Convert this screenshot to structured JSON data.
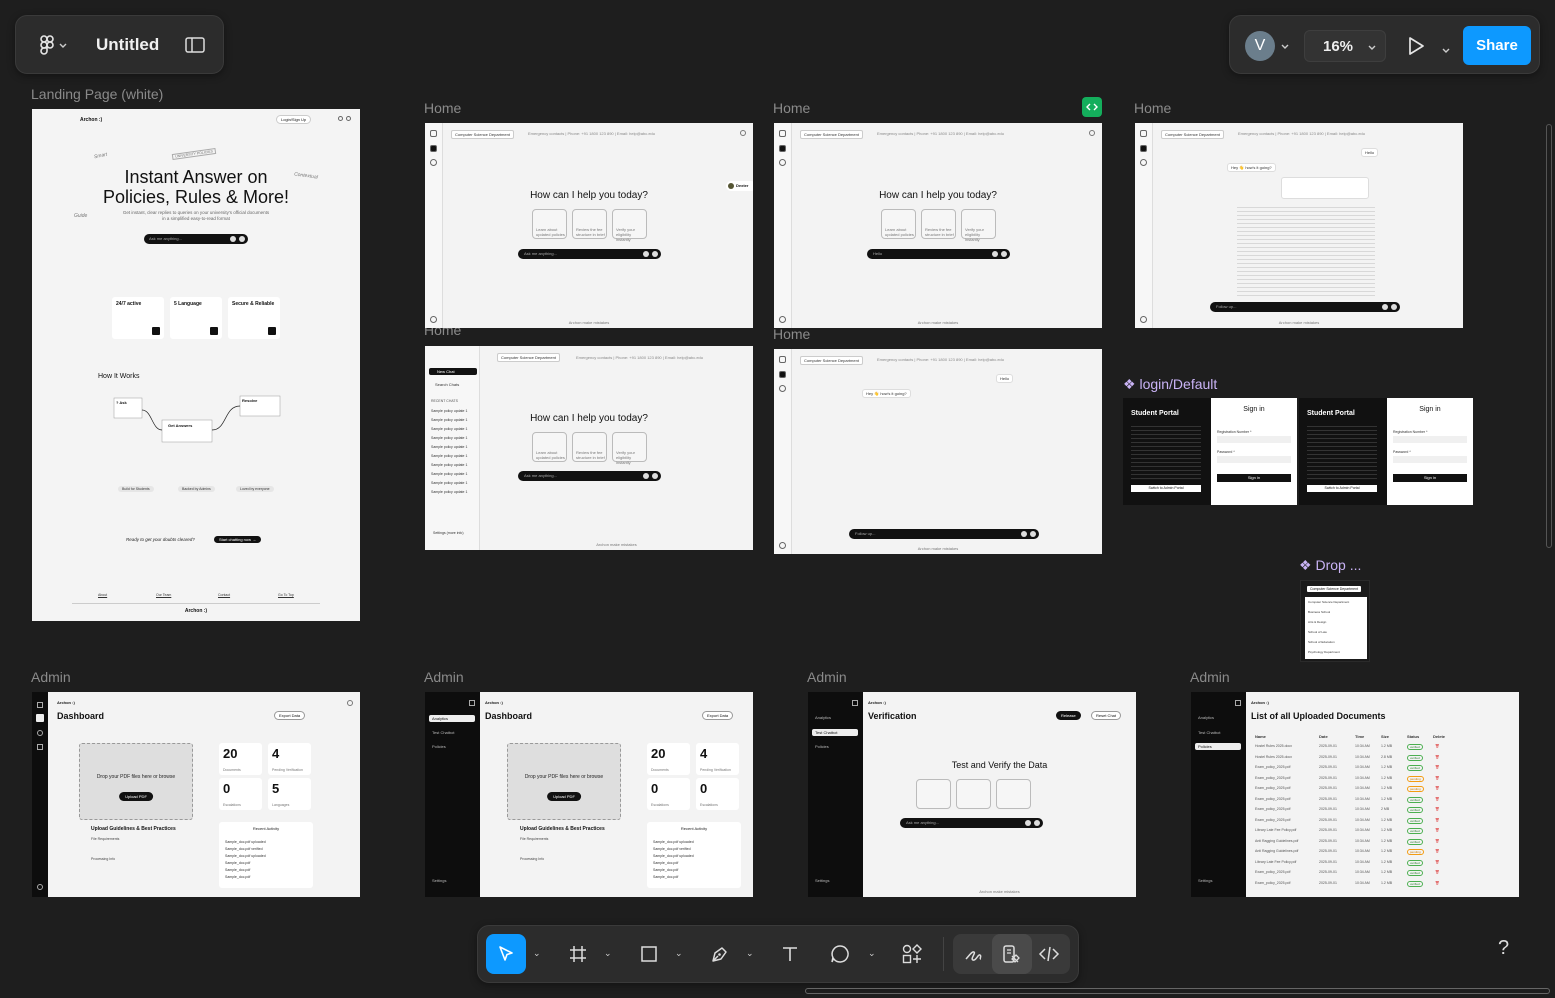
{
  "app": {
    "file_title": "Untitled",
    "zoom": "16%",
    "share_label": "Share",
    "avatar_initial": "V",
    "help_label": "?"
  },
  "colors": {
    "canvas": "#1e1e1e",
    "accent": "#0d99ff",
    "component": "#c9b3f5"
  },
  "frame_labels": {
    "landing": "Landing Page (white)",
    "home1": "Home",
    "home2": "Home",
    "home3": "Home",
    "home4": "Home",
    "home5": "Home",
    "login": "login/Default",
    "drop": "Drop ...",
    "admin1": "Admin",
    "admin2": "Admin",
    "admin3": "Admin",
    "admin4": "Admin"
  },
  "landing": {
    "brand": "Archon :)",
    "login_btn": "Login/Sign Up",
    "hero_line1": "Instant Answer on",
    "hero_line2": "Policies, Rules & More!",
    "hero_sub1": "Get instant, clear replies to queries on your university's official documents",
    "hero_sub2": "in a simplified easy-to-read format",
    "ask_placeholder": "Ask me anything...",
    "doodle1": "Smart",
    "doodle2": "Contextual",
    "doodle3": "Guide",
    "doodle4": "UNIVERSITY POLICIES",
    "features": [
      "24/7 active",
      "5 Language",
      "Secure & Reliable"
    ],
    "how_title": "How It Works",
    "steps": [
      "? Ask",
      "Get Answers",
      "Resolve"
    ],
    "built": [
      "Build for Students",
      "Backed by Admins",
      "Loved by everyone"
    ],
    "cta_text": "Ready to get your doubts cleared?",
    "cta_btn": "Start chatting now →",
    "footer_links": [
      "About",
      "Our Team",
      "Contact",
      "Go To Top"
    ],
    "footer_brand": "Archon :)"
  },
  "home": {
    "dept": "Computer Science Department",
    "contact": "Emergency contacts | Phone: +91 1800 123 890 | Email: help@abc.edu",
    "title": "How can I help you today?",
    "input_ph": "Ask me anything...",
    "input_ph2": "Hello",
    "followup": "Follow up...",
    "footer": "Archon make mistakes",
    "user_msg": "Hey 👋 how's it going?",
    "hello": "Hello",
    "new_chat": "New Chat",
    "search_chats": "Search Chats",
    "recent_chats": "RECENT CHATS",
    "sample": "Sample policy update 1",
    "settings": "Settings (more info)",
    "cards": [
      "Learn about updated policies",
      "Review the fee structure in brief",
      "Verify your eligibility instantly"
    ],
    "avatar_name": "Dexter"
  },
  "login": {
    "portal": "Student Portal",
    "signin": "Sign in",
    "reg_label": "Registration Number *",
    "pw_label": "Password *",
    "signin_btn": "Sign in",
    "admin_btn": "Switch to Admin Portal"
  },
  "dropdown": {
    "header": "Computer Science Department",
    "options": [
      "Computer Science Department",
      "Business School",
      "Arts & Design",
      "School of Law",
      "School of Education",
      "Psychology Department"
    ]
  },
  "admin": {
    "brand": "Archon :)",
    "dashboard": "Dashboard",
    "export": "Export Data",
    "drop_text": "Drop your PDF files here or browse",
    "upload_btn": "Upload PDF",
    "stats": [
      {
        "value": "20",
        "label": "Documents"
      },
      {
        "value": "4",
        "label": "Pending Verification"
      },
      {
        "value": "0",
        "label": "Escalations"
      },
      {
        "value": "5",
        "label": "Languages"
      }
    ],
    "stats2": [
      {
        "value": "20",
        "label": "Documents"
      },
      {
        "value": "4",
        "label": "Pending Verification"
      },
      {
        "value": "0",
        "label": "Escalations"
      },
      {
        "value": "0",
        "label": "Escalations"
      }
    ],
    "guidelines": "Upload Guidelines & Best Practices",
    "file_req": "File Requirements",
    "processing": "Processing Info",
    "recent": "Recent Activity",
    "recent_rows": [
      "Sample_doc.pdf uploaded",
      "Sample_doc.pdf verified",
      "Sample_doc.pdf uploaded",
      "Sample_doc.pdf",
      "Sample_doc.pdf",
      "Sample_doc.pdf"
    ],
    "time_ago": "1 min ago",
    "nav": [
      "Analytics",
      "Test Chatbot",
      "Policies"
    ],
    "settings": "Settings",
    "verification": "Verification",
    "release": "Release",
    "reset": "Reset Chat",
    "test_title": "Test and Verify the Data",
    "ask_ph": "Ask me anything...",
    "list_title": "List of all Uploaded Documents",
    "table_headers": [
      "Name",
      "Date",
      "Time",
      "Size",
      "Status",
      "Delete"
    ],
    "table_rows": [
      [
        "Hostel Rules 2025.docx",
        "2025-09-01",
        "10:34 AM",
        "1.2 MB",
        "verified"
      ],
      [
        "Hostel Rules 2025.docx",
        "2025-09-01",
        "10:34 AM",
        "2.8 MB",
        "verified"
      ],
      [
        "Exam_policy_2025.pdf",
        "2025-09-01",
        "10:34 AM",
        "1.2 MB",
        "verified"
      ],
      [
        "Exam_policy_2025.pdf",
        "2025-09-01",
        "10:34 AM",
        "1.2 MB",
        "pending"
      ],
      [
        "Exam_policy_2025.pdf",
        "2025-09-01",
        "10:34 AM",
        "1.2 MB",
        "pending"
      ],
      [
        "Exam_policy_2025.pdf",
        "2025-09-01",
        "10:34 AM",
        "1.2 MB",
        "verified"
      ],
      [
        "Exam_policy_2025.pdf",
        "2025-09-01",
        "10:34 AM",
        "2 MB",
        "verified"
      ],
      [
        "Exam_policy_2025.pdf",
        "2025-09-01",
        "10:34 AM",
        "1.2 MB",
        "verified"
      ],
      [
        "Library Late Fee Policy.pdf",
        "2025-09-01",
        "10:34 AM",
        "1.2 MB",
        "verified"
      ],
      [
        "Anti Ragging Guidelines.pdf",
        "2025-09-01",
        "10:34 AM",
        "1.2 MB",
        "verified"
      ],
      [
        "Anti Ragging Guidelines.pdf",
        "2025-09-01",
        "10:34 AM",
        "1.2 MB",
        "pending"
      ],
      [
        "Library Late Fee Policy.pdf",
        "2025-09-01",
        "10:34 AM",
        "1.2 MB",
        "verified"
      ],
      [
        "Exam_policy_2025.pdf",
        "2025-09-01",
        "10:34 AM",
        "1.2 MB",
        "verified"
      ],
      [
        "Exam_policy_2025.pdf",
        "2025-09-01",
        "10:34 AM",
        "1.2 MB",
        "verified"
      ]
    ]
  }
}
